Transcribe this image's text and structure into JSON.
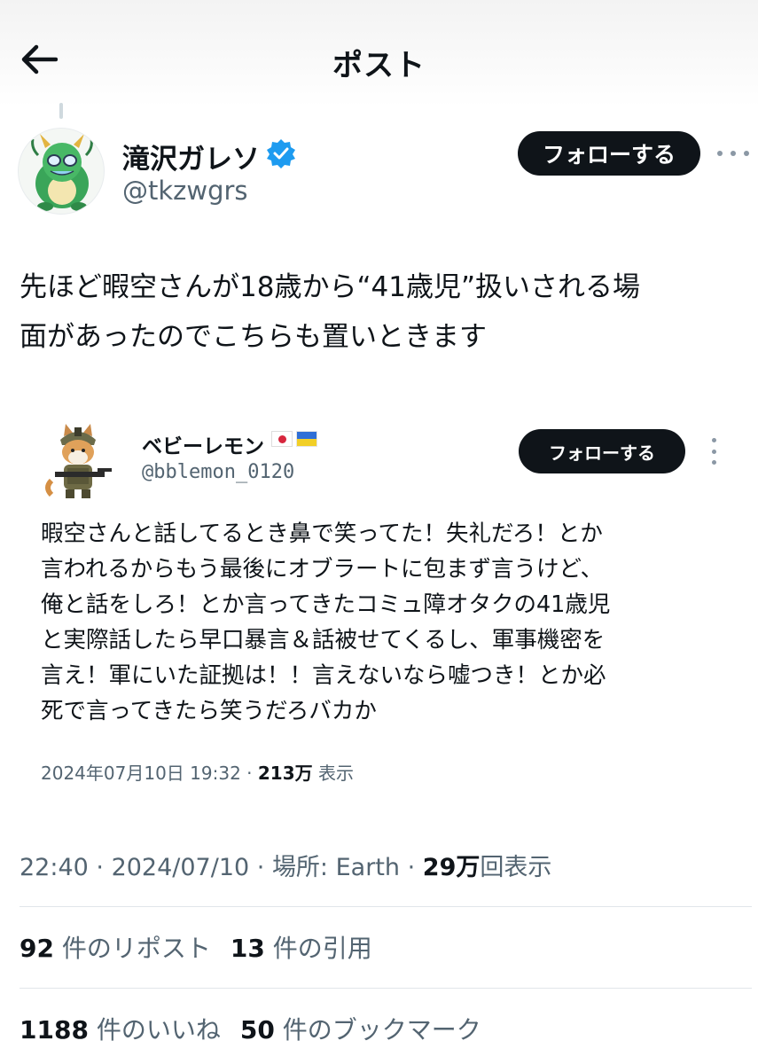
{
  "header": {
    "title": "ポスト"
  },
  "author": {
    "name": "滝沢ガレソ",
    "handle": "@tkzwgrs",
    "follow_label": "フォローする"
  },
  "post": {
    "text": "先ほど暇空さんが18歳から“41歳児”扱いされる場\n面があったのでこちらも置いときます"
  },
  "quoted": {
    "name": "ベビーレモン",
    "flags": [
      "japan-flag-icon",
      "ukraine-flag-icon"
    ],
    "handle": "@bblemon_0120",
    "follow_label": "フォローする",
    "text": "暇空さんと話してるとき鼻で笑ってた！失礼だろ！とか\n言われるからもう最後にオブラートに包まず言うけど、\n俺と話をしろ！とか言ってきたコミュ障オタクの41歳児\nと実際話したら早口暴言＆話被せてくるし、軍事機密を\n言え！軍にいた証拠は！！言えないなら嘘つき！とか必\n死で言ってきたら笑うだろバカか",
    "datetime": "2024年07月10日 19:32",
    "sep": " · ",
    "views": "213万",
    "views_label": " 表示"
  },
  "meta": {
    "time": "22:40",
    "sep": " · ",
    "date": "2024/07/10",
    "location": "場所: Earth",
    "views": "29万",
    "views_label": "回表示"
  },
  "stats": {
    "reposts_count": "92",
    "reposts_label": "件のリポスト",
    "quotes_count": "13",
    "quotes_label": "件の引用",
    "likes_count": "1188",
    "likes_label": "件のいいね",
    "bookmarks_count": "50",
    "bookmarks_label": "件のブックマーク"
  },
  "colors": {
    "accent": "#1d9bf0",
    "text": "#0f1419",
    "muted": "#536471",
    "button": "#0f1419"
  }
}
